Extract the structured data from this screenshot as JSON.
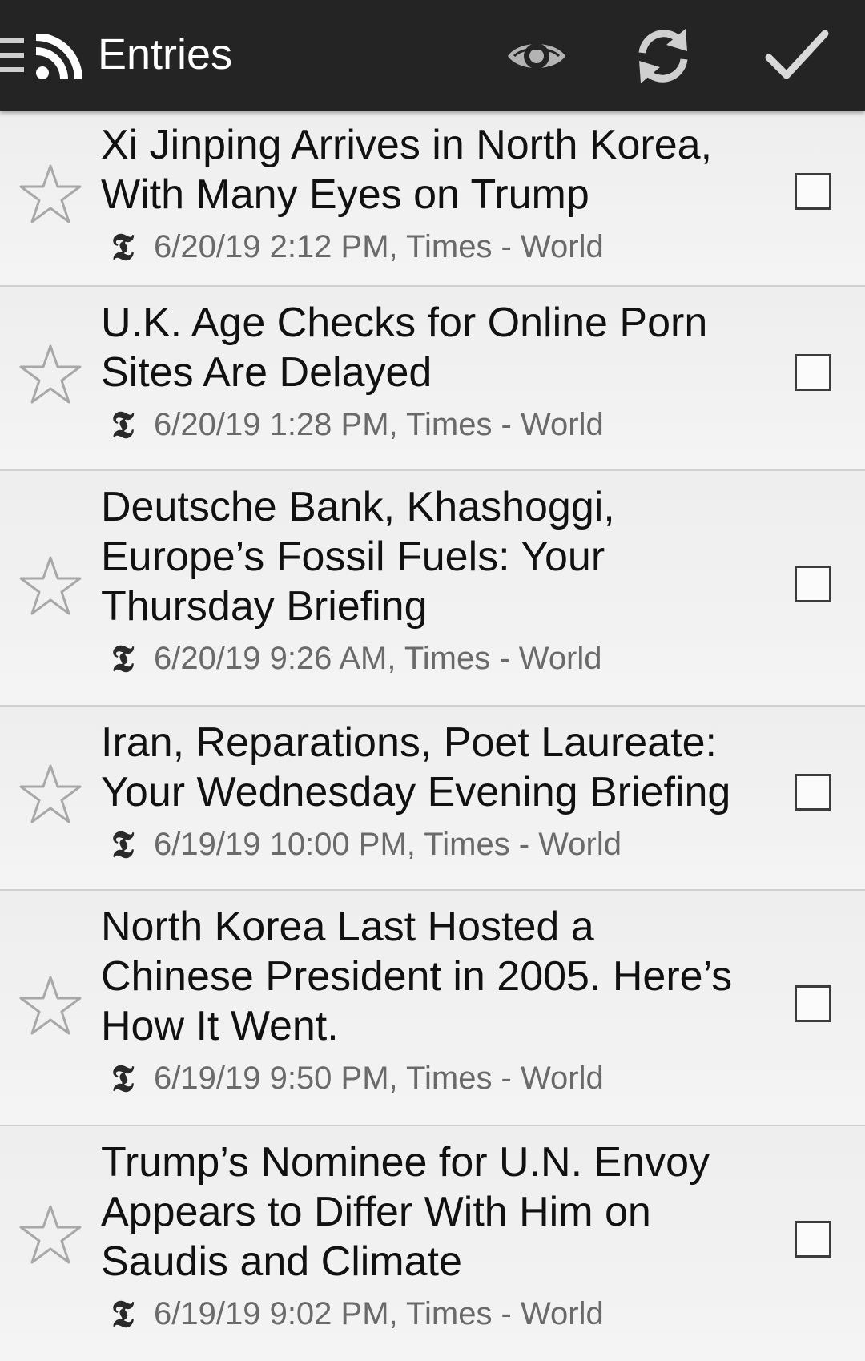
{
  "toolbar": {
    "title": "Entries",
    "feed_icon": "rss-icon",
    "actions": [
      {
        "name": "toggle-read-visibility",
        "icon": "eye-icon"
      },
      {
        "name": "refresh",
        "icon": "refresh-icon"
      },
      {
        "name": "mark-all-read",
        "icon": "checkmark-icon"
      }
    ]
  },
  "entries": [
    {
      "title": "Xi Jinping Arrives in North Korea, With Many Eyes on Trump",
      "date_feed": "6/20/19 2:12 PM, Times - World",
      "feed_icon_glyph": "𝕿",
      "starred": false,
      "checked": false
    },
    {
      "title": "U.K. Age Checks for Online Porn Sites Are Delayed",
      "date_feed": "6/20/19 1:28 PM, Times - World",
      "feed_icon_glyph": "𝕿",
      "starred": false,
      "checked": false
    },
    {
      "title": "Deutsche Bank, Khashoggi, Europe’s Fossil Fuels: Your Thursday Briefing",
      "date_feed": "6/20/19 9:26 AM, Times - World",
      "feed_icon_glyph": "𝕿",
      "starred": false,
      "checked": false
    },
    {
      "title": "Iran, Reparations, Poet Laureate: Your Wednesday Evening Briefing",
      "date_feed": "6/19/19 10:00 PM, Times - World",
      "feed_icon_glyph": "𝕿",
      "starred": false,
      "checked": false
    },
    {
      "title": "North Korea Last Hosted a Chinese President in 2005. Here’s How It Went.",
      "date_feed": "6/19/19 9:50 PM, Times - World",
      "feed_icon_glyph": "𝕿",
      "starred": false,
      "checked": false
    },
    {
      "title": "Trump’s Nominee for U.N. Envoy Appears to Differ With Him on Saudis and Climate",
      "date_feed": "6/19/19 9:02 PM, Times - World",
      "feed_icon_glyph": "𝕿",
      "starred": false,
      "checked": false
    }
  ]
}
